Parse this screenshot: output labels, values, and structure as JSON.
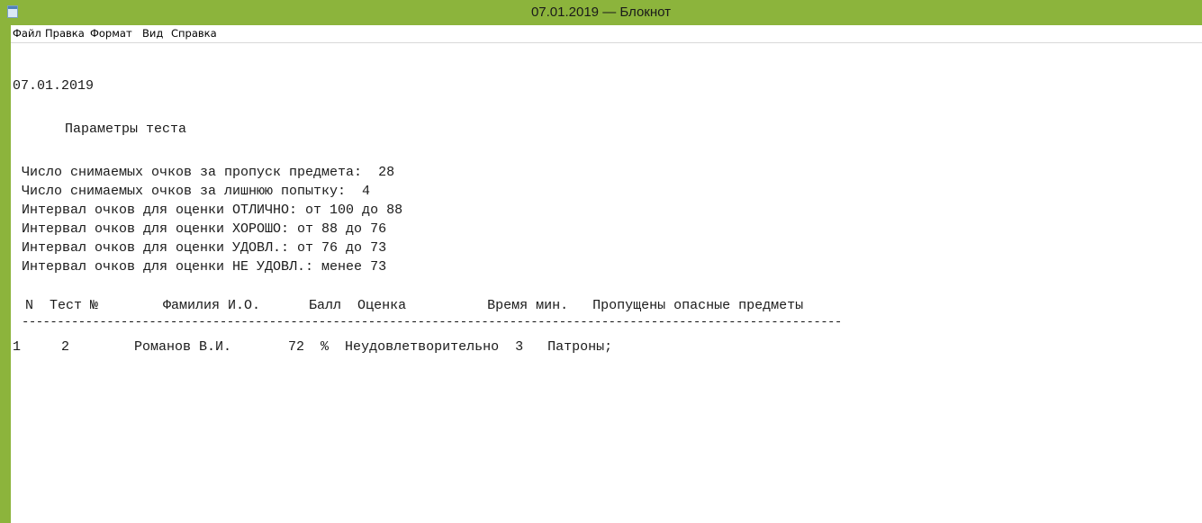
{
  "window": {
    "title": "07.01.2019 — Блокнот"
  },
  "menu": [
    "Файл",
    "Правка",
    "Формат",
    "Вид",
    "Справка"
  ],
  "document": {
    "date": "07.01.2019",
    "section_heading": "Параметры теста",
    "parameters": [
      "Число снимаемых очков за пропуск предмета:  28",
      "Число снимаемых очков за лишнюю попытку:  4",
      "Интервал очков для оценки ОТЛИЧНО: от 100 до 88",
      "Интервал очков для оценки ХОРОШО: от 88 до 76",
      "Интервал очков для оценки УДОВЛ.: от 76 до 73",
      "Интервал очков для оценки НЕ УДОВЛ.: менее 73"
    ],
    "table_header": "N  Тест №        Фамилия И.О.      Балл  Оценка          Время мин.   Пропущены опасные предметы",
    "separator": "--------------------------------------------------------------------------------------------------------------------",
    "table_rows": [
      "1     2        Романов В.И.       72  %  Неудовлетворительно  3   Патроны;"
    ]
  }
}
